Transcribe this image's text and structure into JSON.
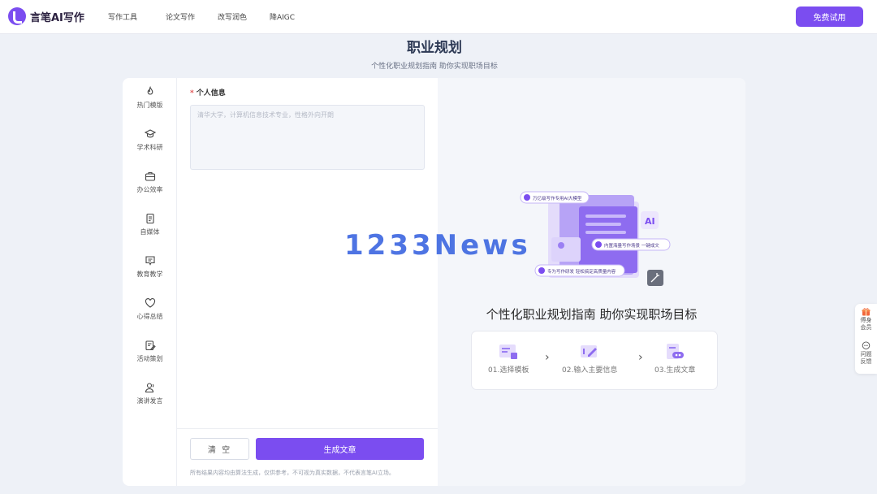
{
  "header": {
    "logo_text": "言笔AI写作",
    "nav": [
      "写作工具",
      "论文写作",
      "改写润色",
      "降AIGC"
    ],
    "cta_label": "免费试用"
  },
  "page": {
    "title": "职业规划",
    "subtitle": "个性化职业规划指南 助你实现职场目标"
  },
  "sidebar": {
    "items": [
      {
        "label": "热门模版",
        "icon": "fire-icon"
      },
      {
        "label": "学术科研",
        "icon": "graduation-cap-icon"
      },
      {
        "label": "办公效率",
        "icon": "briefcase-icon"
      },
      {
        "label": "自媒体",
        "icon": "document-icon"
      },
      {
        "label": "教育教学",
        "icon": "chat-board-icon"
      },
      {
        "label": "心得总结",
        "icon": "heart-icon"
      },
      {
        "label": "活动策划",
        "icon": "clipboard-edit-icon"
      },
      {
        "label": "演讲发言",
        "icon": "speaker-icon"
      }
    ]
  },
  "form": {
    "field_label": "个人信息",
    "placeholder": "清华大学，计算机信息技术专业，性格外向开朗",
    "clear_label": "清 空",
    "generate_label": "生成文章",
    "disclaimer": "所有结果内容均由算法生成，仅供参考，不可视为真实数据，不代表言笔AI立场。"
  },
  "preview": {
    "badge_1": "万亿级写作专用AI大模型",
    "badge_2": "内置海量写作场景 一键成文",
    "badge_3": "专为写作研发 轻松搞定高质量内容",
    "ai_mark": "AI",
    "title": "个性化职业规划指南 助你实现职场目标",
    "steps": [
      "01.选择模板",
      "02.输入主要信息",
      "03.生成文章"
    ]
  },
  "watermark": "1233News",
  "float_panel": {
    "items": [
      {
        "label": "傅身会员",
        "icon": "gift-icon"
      },
      {
        "label": "问题反馈",
        "icon": "feedback-icon"
      }
    ]
  },
  "colors": {
    "accent": "#7b4df0",
    "watermark": "#3b66e0"
  }
}
